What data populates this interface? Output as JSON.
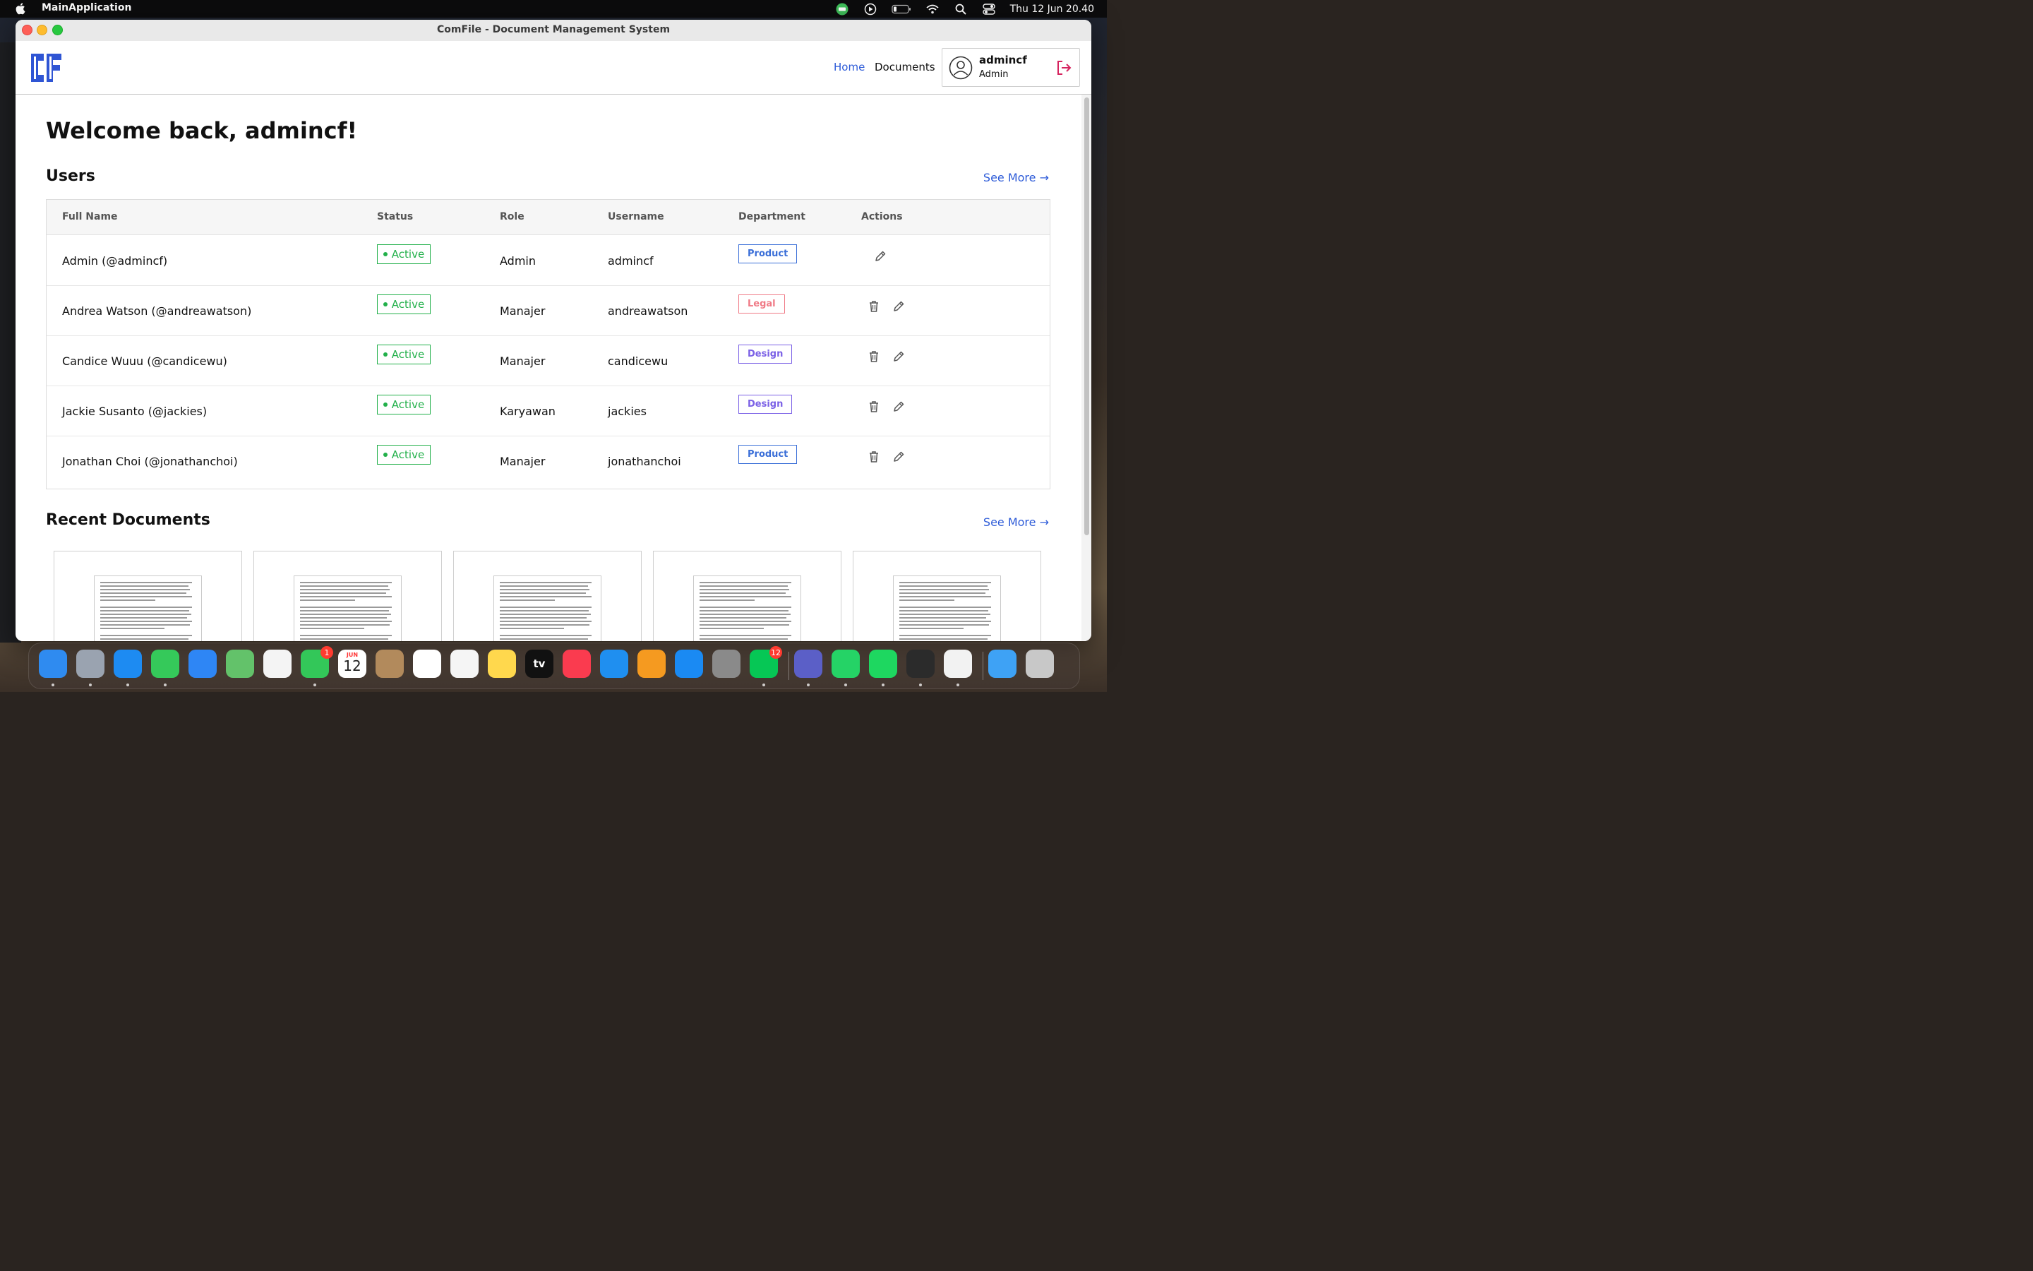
{
  "menubar": {
    "app_name": "MainApplication",
    "clock": "Thu 12 Jun  20.40",
    "icons": [
      "line-icon",
      "play-icon",
      "battery-icon",
      "wifi-icon",
      "search-icon",
      "control-center-icon"
    ]
  },
  "window": {
    "title": "ComFile - Document Management System"
  },
  "header": {
    "logo_text": "CF",
    "nav": {
      "home": "Home",
      "documents": "Documents"
    },
    "user": {
      "name": "admincf",
      "role": "Admin"
    },
    "colors": {
      "accent": "#2d5bd8",
      "logout": "#d6245f"
    }
  },
  "main": {
    "welcome": "Welcome back, admincf!",
    "users_section": {
      "title": "Users",
      "see_more": "See More →",
      "columns": [
        "Full Name",
        "Status",
        "Role",
        "Username",
        "Department",
        "Actions"
      ],
      "rows": [
        {
          "full_name": "Admin (@admincf)",
          "status": "Active",
          "role": "Admin",
          "username": "admincf",
          "department": "Product",
          "dept_color": "#3b6fd8",
          "can_delete": false
        },
        {
          "full_name": "Andrea Watson (@andreawatson)",
          "status": "Active",
          "role": "Manajer",
          "username": "andreawatson",
          "department": "Legal",
          "dept_color": "#f07a86",
          "can_delete": true
        },
        {
          "full_name": "Candice Wuuu (@candicewu)",
          "status": "Active",
          "role": "Manajer",
          "username": "candicewu",
          "department": "Design",
          "dept_color": "#7b61e6",
          "can_delete": true
        },
        {
          "full_name": "Jackie Susanto (@jackies)",
          "status": "Active",
          "role": "Karyawan",
          "username": "jackies",
          "department": "Design",
          "dept_color": "#7b61e6",
          "can_delete": true
        },
        {
          "full_name": "Jonathan Choi (@jonathanchoi)",
          "status": "Active",
          "role": "Manajer",
          "username": "jonathanchoi",
          "department": "Product",
          "dept_color": "#3b6fd8",
          "can_delete": true
        }
      ],
      "status_color": "#22b04a"
    },
    "documents_section": {
      "title": "Recent Documents",
      "see_more": "See More →",
      "document_count": 5
    }
  },
  "dock": {
    "apps": [
      "finder",
      "launchpad",
      "safari",
      "messages",
      "mail",
      "maps",
      "photos",
      "facetime",
      "calendar",
      "contacts",
      "reminders",
      "freeform",
      "notes",
      "apple-tv",
      "music",
      "keynote",
      "pages",
      "app-store",
      "system-settings",
      "line",
      "teams",
      "whatsapp",
      "spotify",
      "virtualbox",
      "java",
      "downloads-folder",
      "trash"
    ],
    "badges": {
      "facetime": "1",
      "line": "12"
    },
    "calendar": {
      "month": "JUN",
      "day": "12"
    },
    "tv_label": "tv"
  }
}
